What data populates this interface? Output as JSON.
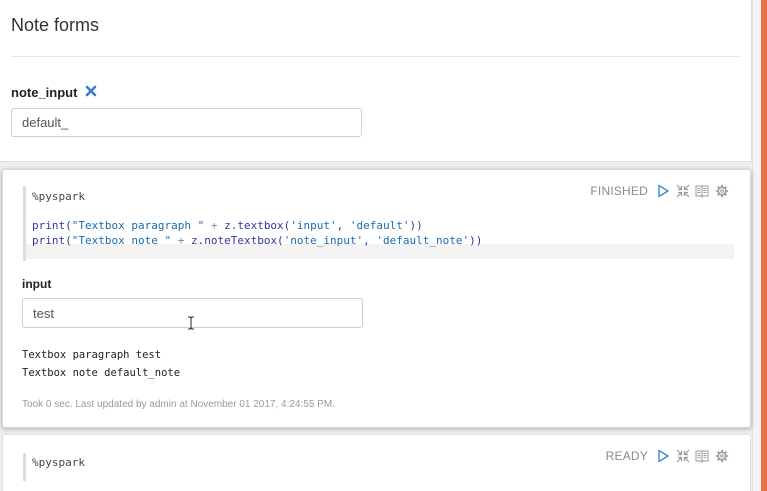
{
  "note_forms": {
    "title": "Note forms",
    "field_label": "note_input",
    "field_value": "default_"
  },
  "paragraphs": [
    {
      "status": "FINISHED",
      "code": {
        "magic": "%pyspark",
        "line1": {
          "fn": "print(",
          "str1": "\"Textbox paragraph \"",
          "op": " + ",
          "call": "z.textbox(",
          "arg1": "'input'",
          "sep": ", ",
          "arg2": "'default'",
          "close": "))"
        },
        "line2": {
          "fn": "print(",
          "str1": "\"Textbox note \"",
          "op": " + ",
          "call": "z.noteTextbox(",
          "arg1": "'note_input'",
          "sep": ", ",
          "arg2": "'default_note'",
          "close": "))"
        }
      },
      "form_label": "input",
      "form_value": "test",
      "output": [
        "Textbox paragraph test",
        "Textbox note default_note"
      ],
      "footer": "Took 0 sec. Last updated by admin at November 01 2017, 4:24:55 PM."
    },
    {
      "status": "READY",
      "code": {
        "magic": "%pyspark"
      }
    }
  ],
  "icons": {
    "remove": "close-x-icon",
    "run": "play-icon",
    "hide_editor": "collapse-arrows-icon",
    "toggle_output": "book-icon",
    "settings": "gear-icon",
    "text_cursor": "text-cursor-icon"
  },
  "colors": {
    "accent_bar": "#e8734a",
    "run_icon": "#3a8bd6",
    "remove_icon": "#3a7bc8"
  }
}
